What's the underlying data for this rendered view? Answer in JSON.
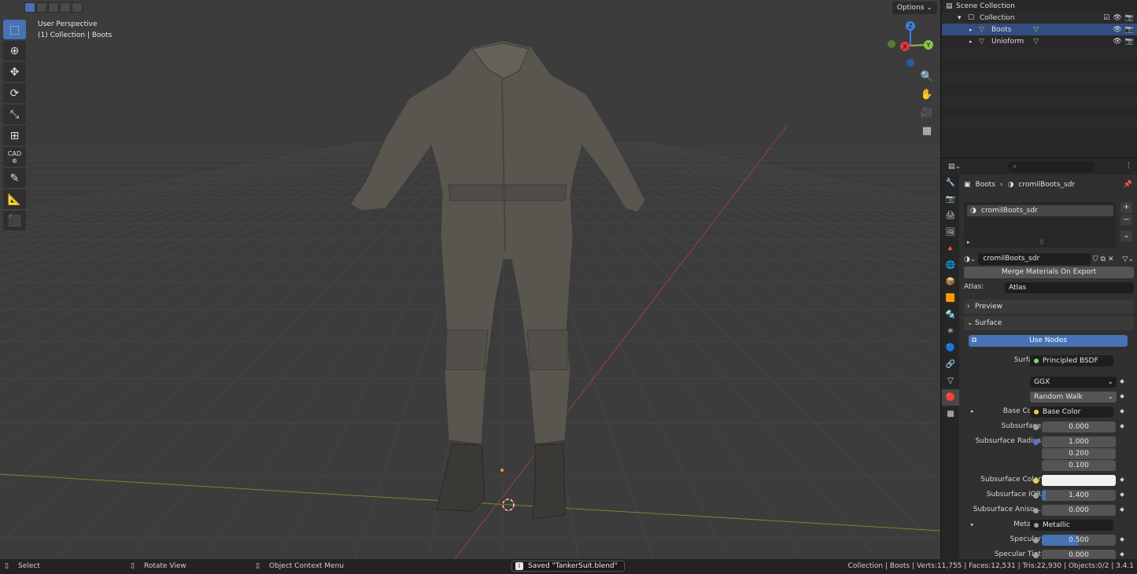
{
  "viewport": {
    "perspective_label": "User Perspective",
    "context_label": "(1) Collection | Boots",
    "options_label": "Options",
    "gizmo": {
      "z": "Z",
      "y": "Y",
      "x": "X"
    },
    "cad_label": "CAD"
  },
  "outliner": {
    "root": "Scene Collection",
    "collection": "Collection",
    "objects": [
      {
        "name": "Boots"
      },
      {
        "name": "Unioform"
      }
    ]
  },
  "properties": {
    "breadcrumb": {
      "object": "Boots",
      "material": "cromilBoots_sdr"
    },
    "slot": "cromilBoots_sdr",
    "material_name": "cromilBoots_sdr",
    "merge_button": "Merge Materials On Export",
    "atlas_label": "Atlas:",
    "atlas_value": "Atlas",
    "preview_panel": "Preview",
    "surface_panel": "Surface",
    "use_nodes": "Use Nodes",
    "surface_label": "Surface",
    "surface_value": "Principled BSDF",
    "distribution": "GGX",
    "sss_method": "Random Walk",
    "fields": {
      "base_color_label": "Base Color",
      "base_color_value": "Base Color",
      "subsurface_label": "Subsurface",
      "subsurface_value": "0.000",
      "subsurface_radius_label": "Subsurface Radius",
      "radius_1": "1.000",
      "radius_2": "0.200",
      "radius_3": "0.100",
      "subsurface_color_label": "Subsurface Color",
      "subsurface_ior_label": "Subsurface IOR",
      "subsurface_ior_value": "1.400",
      "subsurface_ior_fraction": 0.05,
      "subsurface_aniso_label": "Subsurface Aniso...",
      "subsurface_aniso_value": "0.000",
      "metallic_label": "Metallic",
      "metallic_value": "Metallic",
      "specular_label": "Specular",
      "specular_value": "0.500",
      "specular_fraction": 0.5,
      "specular_tint_label": "Specular Tint",
      "specular_tint_value": "0.000"
    }
  },
  "statusbar": {
    "select": "Select",
    "rotate": "Rotate View",
    "context_menu": "Object Context Menu",
    "toast": "Saved \"TankerSuit.blend\"",
    "stats": "Collection | Boots | Verts:11,755 | Faces:12,531 | Tris:22,930 | Objects:0/2 | 3.4.1"
  },
  "colors": {
    "accent": "#4772b3",
    "x_axis": "#e03a3a",
    "y_axis": "#8bc34a",
    "z_axis": "#3f7fe0"
  }
}
